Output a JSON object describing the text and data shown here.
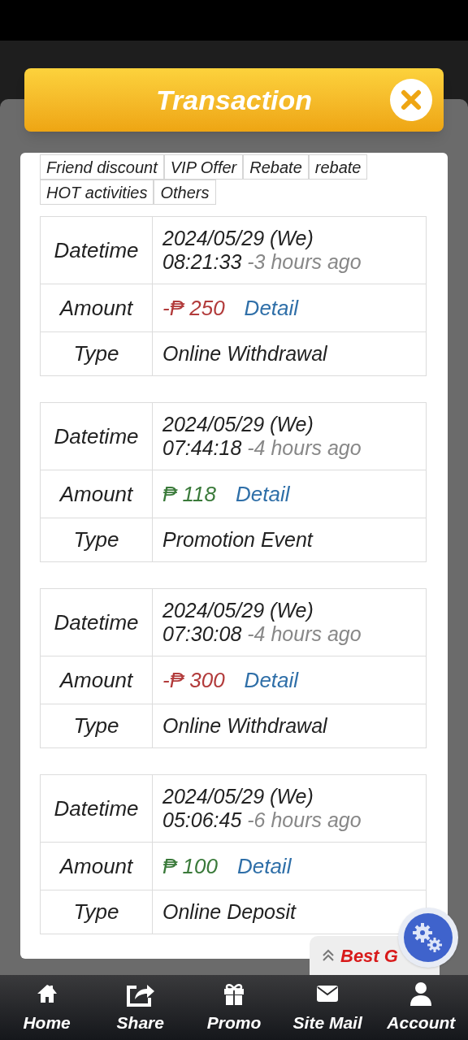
{
  "dialog": {
    "title": "Transaction"
  },
  "filters": [
    {
      "label": "Friend discount"
    },
    {
      "label": "VIP Offer"
    },
    {
      "label": "Rebate"
    },
    {
      "label": "rebate"
    },
    {
      "label": "HOT activities"
    },
    {
      "label": "Others"
    }
  ],
  "transactions": [
    {
      "datetime_label": "Datetime",
      "date": "2024/05/29 (We)",
      "time": "08:21:33",
      "ago": "-3 hours ago",
      "amount_label": "Amount",
      "amount": "-₱ 250",
      "kind": "debit",
      "detail": "Detail",
      "type_label": "Type",
      "type": "Online Withdrawal"
    },
    {
      "datetime_label": "Datetime",
      "date": "2024/05/29 (We)",
      "time": "07:44:18",
      "ago": "-4 hours ago",
      "amount_label": "Amount",
      "amount": "₱ 118",
      "kind": "credit",
      "detail": "Detail",
      "type_label": "Type",
      "type": "Promotion Event"
    },
    {
      "datetime_label": "Datetime",
      "date": "2024/05/29 (We)",
      "time": "07:30:08",
      "ago": "-4 hours ago",
      "amount_label": "Amount",
      "amount": "-₱ 300",
      "kind": "debit",
      "detail": "Detail",
      "type_label": "Type",
      "type": "Online Withdrawal"
    },
    {
      "datetime_label": "Datetime",
      "date": "2024/05/29 (We)",
      "time": "05:06:45",
      "ago": "-6 hours ago",
      "amount_label": "Amount",
      "amount": "₱ 100",
      "kind": "credit",
      "detail": "Detail",
      "type_label": "Type",
      "type": "Online Deposit"
    }
  ],
  "floating_tab": {
    "label": "Best G"
  },
  "nav": [
    {
      "kind": "home",
      "label": "Home"
    },
    {
      "kind": "share",
      "label": "Share"
    },
    {
      "kind": "promo",
      "label": "Promo"
    },
    {
      "kind": "mail",
      "label": "Site Mail"
    },
    {
      "kind": "account",
      "label": "Account"
    }
  ]
}
